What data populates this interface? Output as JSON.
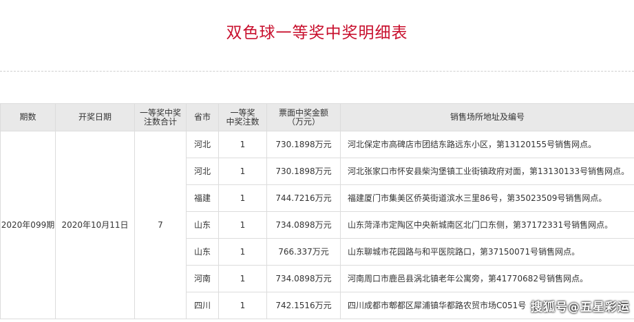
{
  "page": {
    "title": "双色球一等奖中奖明细表"
  },
  "table": {
    "headers": {
      "period": "期数",
      "draw_date": "开奖日期",
      "total_l1": "一等奖中奖",
      "total_l2": "注数合计",
      "province": "省市",
      "wins_l1": "一等奖",
      "wins_l2": "中奖注数",
      "amount_l1": "票面中奖金额",
      "amount_l2": "（万元）",
      "address": "销售场所地址及编号"
    },
    "period": "2020年099期",
    "draw_date": "2020年10月11日",
    "total": "7",
    "rows": [
      {
        "province": "河北",
        "wins": "1",
        "amount": "730.1898万元",
        "address": "河北保定市高碑店市团结东路远东小区，第13120155号销售网点。"
      },
      {
        "province": "河北",
        "wins": "1",
        "amount": "730.1898万元",
        "address": "河北张家口市怀安县柴沟堡镇工业街镇政府对面，第13130133号销售网点。"
      },
      {
        "province": "福建",
        "wins": "1",
        "amount": "744.7216万元",
        "address": "福建厦门市集美区侨英街道滨水三里86号，第35023509号销售网点。"
      },
      {
        "province": "山东",
        "wins": "1",
        "amount": "734.0898万元",
        "address": "山东菏泽市定陶区中央新城南区北门口东侧，第37172331号销售网点。"
      },
      {
        "province": "山东",
        "wins": "1",
        "amount": "766.337万元",
        "address": "山东聊城市花园路与和平医院路口，第37150071号销售网点。"
      },
      {
        "province": "河南",
        "wins": "1",
        "amount": "734.0898万元",
        "address": "河南周口市鹿邑县涡北镇老年公寓旁，第41770682号销售网点。"
      },
      {
        "province": "四川",
        "wins": "1",
        "amount": "742.1516万元",
        "address": "四川成都市郫都区犀浦镇华都路农贸市场C051号"
      }
    ]
  },
  "watermark": "搜狐号@五星彩运"
}
